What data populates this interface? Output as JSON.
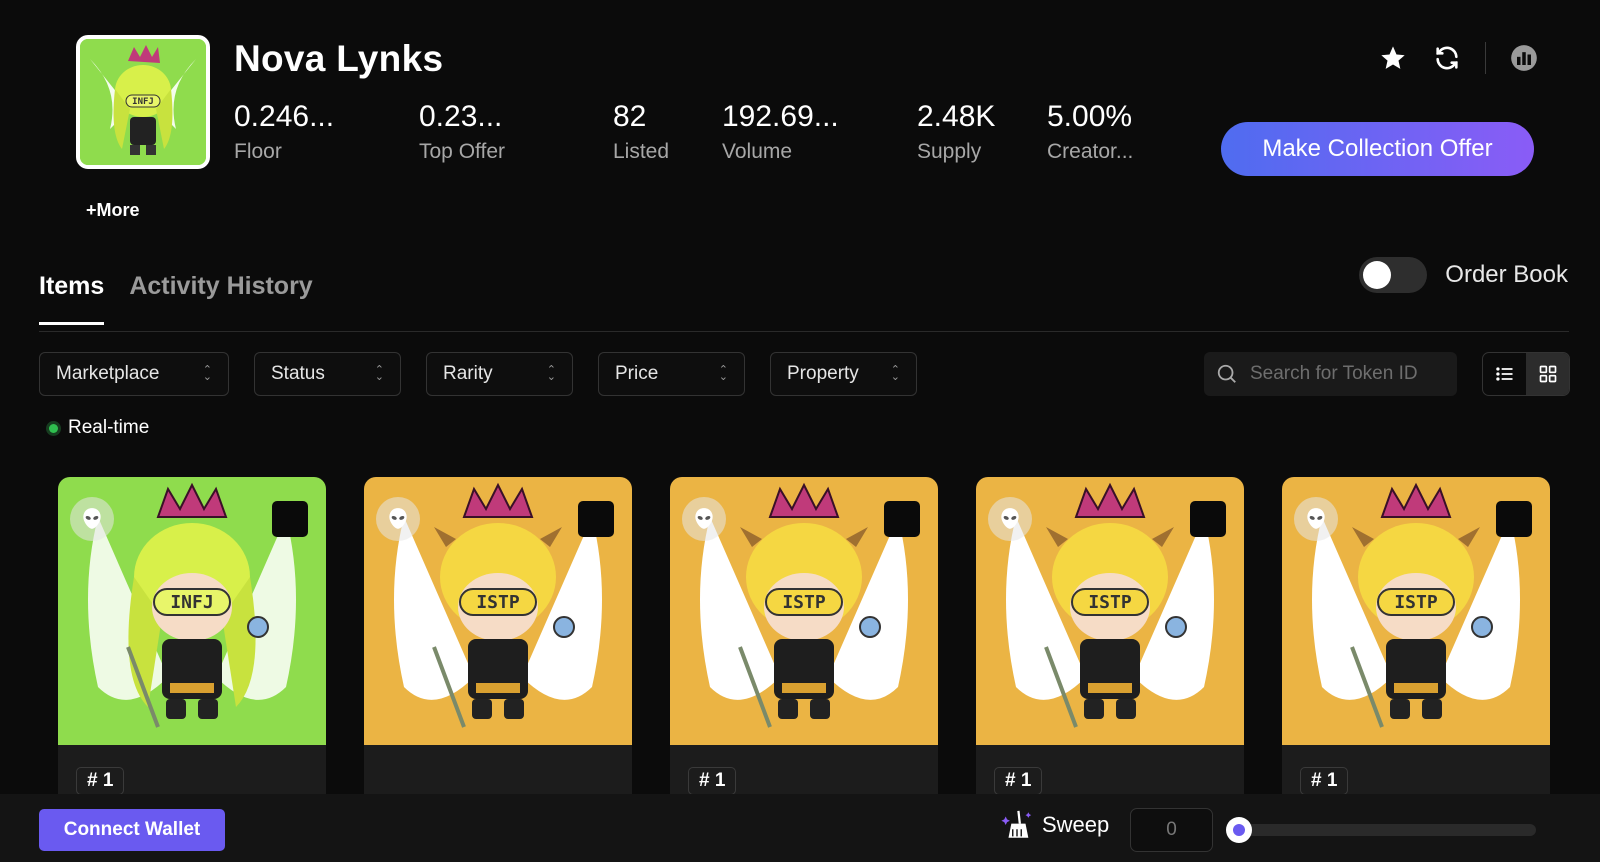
{
  "collection": {
    "name": "Nova Lynks",
    "more_label": "+More",
    "offer_button": "Make Collection Offer",
    "avatar_text": "INFJ",
    "stats": [
      {
        "value": "0.246...",
        "label": "Floor"
      },
      {
        "value": "0.23...",
        "label": "Top Offer"
      },
      {
        "value": "82",
        "label": "Listed"
      },
      {
        "value": "192.69...",
        "label": "Volume"
      },
      {
        "value": "2.48K",
        "label": "Supply"
      },
      {
        "value": "5.00%",
        "label": "Creator..."
      }
    ],
    "header_icons": [
      "star-icon",
      "refresh-icon",
      "chart-brand-icon"
    ]
  },
  "tabs": [
    {
      "label": "Items",
      "active": true
    },
    {
      "label": "Activity History",
      "active": false
    }
  ],
  "order_book": {
    "label": "Order Book",
    "enabled": false
  },
  "filters": [
    "Marketplace",
    "Status",
    "Rarity",
    "Price",
    "Property"
  ],
  "search": {
    "placeholder": "Search for Token ID",
    "value": ""
  },
  "view_mode": "grid",
  "realtime_label": "Real-time",
  "items": [
    {
      "label": "INFJ",
      "token": "# 1",
      "bg": "#8fdc4d"
    },
    {
      "label": "ISTP",
      "token": "",
      "bg": "#ebb444"
    },
    {
      "label": "ISTP",
      "token": "# 1",
      "bg": "#ebb444"
    },
    {
      "label": "ISTP",
      "token": "# 1",
      "bg": "#ebb444"
    },
    {
      "label": "ISTP",
      "token": "# 1",
      "bg": "#ebb444"
    }
  ],
  "footer": {
    "connect_label": "Connect Wallet",
    "sweep_label": "Sweep",
    "sweep_value": "0",
    "sweep_fraction": 0
  },
  "colors": {
    "accent": "#6a5af0",
    "realtime": "#2fbf4f",
    "offer_gradient_start": "#4f6cf0",
    "offer_gradient_end": "#8a5cf6"
  }
}
